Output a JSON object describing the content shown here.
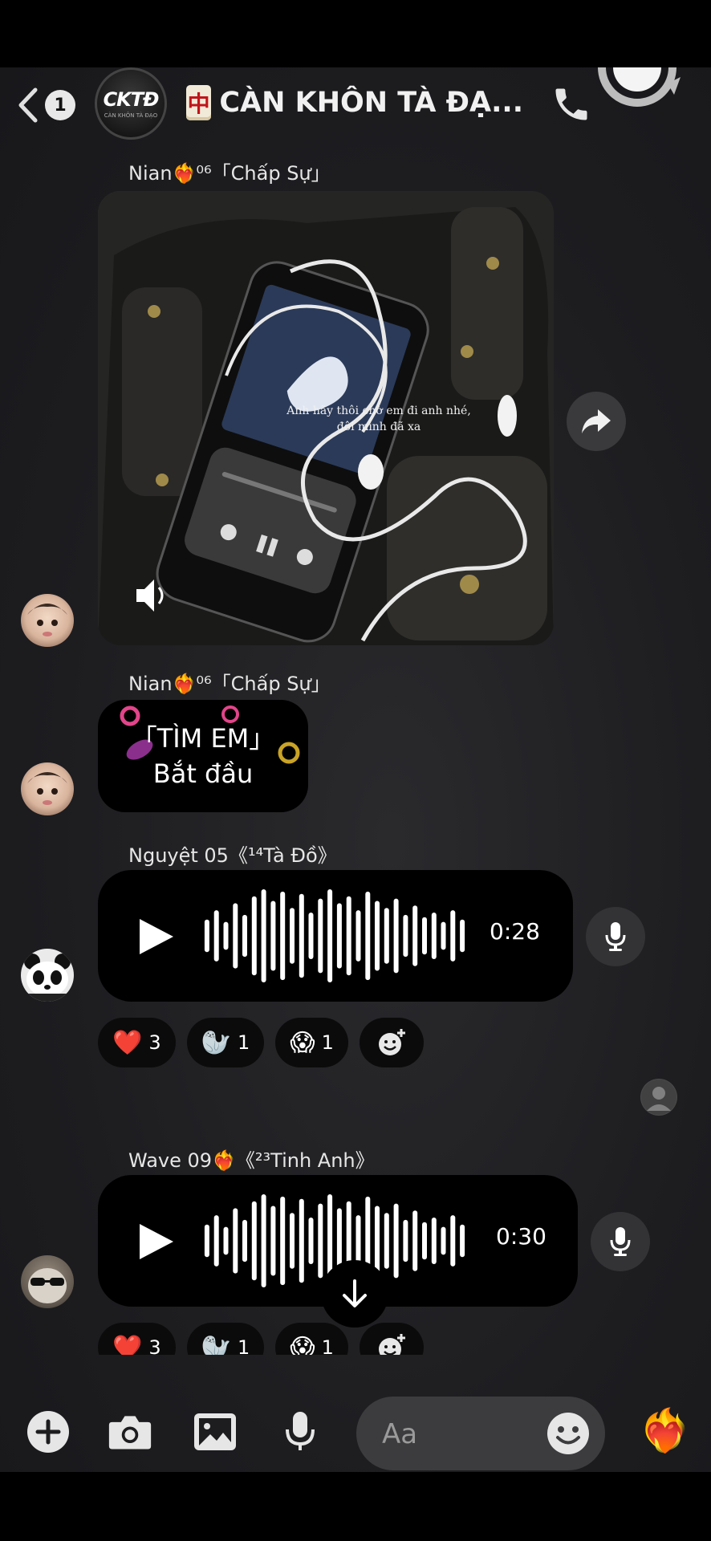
{
  "header": {
    "back_count": "1",
    "group_logo": "CKTĐ",
    "group_logo_sub": "CÀN KHÔN TÀ ĐẠO",
    "title_tile": "中",
    "title": "CÀN KHÔN TÀ ĐẠ..."
  },
  "messages": [
    {
      "sender": "Nian❤️‍🔥⁰⁶「Chấp Sự」",
      "type": "video",
      "caption_line1": "Anh hãy thôi chờ em đi anh nhé,",
      "caption_line2": "đôi mình đã xa"
    },
    {
      "sender": "Nian❤️‍🔥⁰⁶「Chấp Sự」",
      "type": "text",
      "line1": "「TÌM EM」",
      "line2": "Bắt đầu"
    },
    {
      "sender": "Nguyệt 05《¹⁴Tà Đồ》",
      "type": "voice",
      "duration": "0:28",
      "reactions": [
        {
          "emoji": "❤️",
          "count": "3"
        },
        {
          "emoji": "🦭",
          "count": "1"
        },
        {
          "emoji": "😱",
          "count": "1"
        }
      ]
    },
    {
      "sender": "Wave 09❤️‍🔥《²³Tinh Anh》",
      "type": "voice",
      "duration": "0:30",
      "reactions": [
        {
          "emoji": "❤️",
          "count": "3"
        },
        {
          "emoji": "🦭",
          "count": "1"
        },
        {
          "emoji": "😱",
          "count": "1"
        }
      ]
    }
  ],
  "add_reaction_icon": "smile-plus-icon",
  "composer": {
    "placeholder": "Aa",
    "like_emoji": "❤️‍🔥"
  },
  "colors": {
    "background": "#1d1d20",
    "bubble": "#000000",
    "text": "#ffffff",
    "composer": "#3c3c3f"
  }
}
